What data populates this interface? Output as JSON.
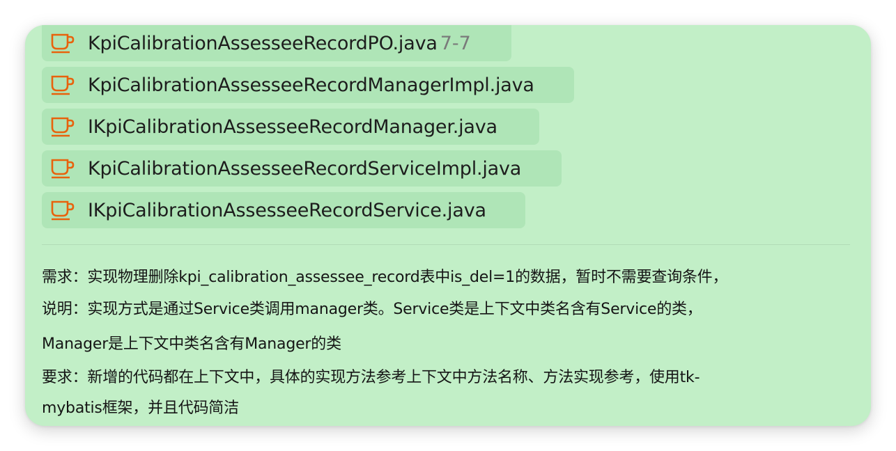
{
  "files": [
    {
      "name": "KpiCalibrationAssesseeRecordPO.java",
      "range": "7-7"
    },
    {
      "name": "KpiCalibrationAssesseeRecordManagerImpl.java",
      "range": ""
    },
    {
      "name": "IKpiCalibrationAssesseeRecordManager.java",
      "range": ""
    },
    {
      "name": "KpiCalibrationAssesseeRecordServiceImpl.java",
      "range": ""
    },
    {
      "name": "IKpiCalibrationAssesseeRecordService.java",
      "range": ""
    }
  ],
  "file_icon": "coffee-cup-icon",
  "colors": {
    "card_background": "#c2efc7",
    "icon": "#e8620c"
  },
  "message": {
    "line1": "需求：实现物理删除kpi_calibration_assessee_record表中is_del=1的数据，暂时不需要查询条件，",
    "line2": "说明：实现方式是通过Service类调用manager类。Service类是上下文中类名含有Service的类，",
    "line3": "Manager是上下文中类名含有Manager的类",
    "line4": "要求：新增的代码都在上下文中，具体的实现方法参考上下文中方法名称、方法实现参考，使用tk-",
    "line5": "mybatis框架，并且代码简洁"
  }
}
